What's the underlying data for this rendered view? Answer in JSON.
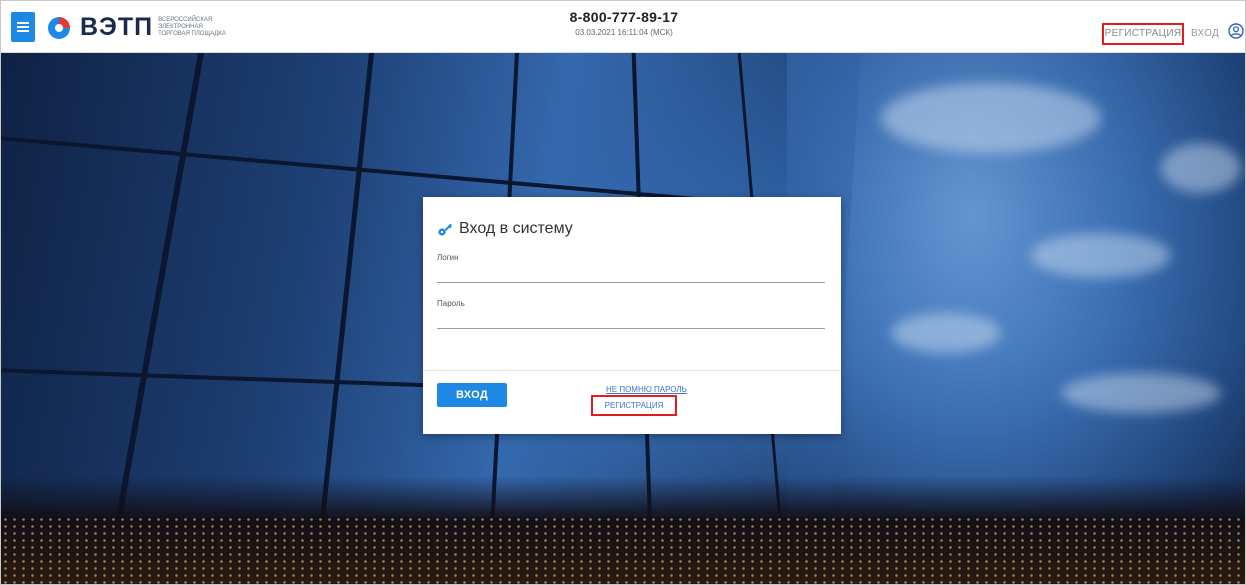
{
  "header": {
    "brand": {
      "word": "ВЭТП",
      "sub_lines": [
        "ВСЕРОССИЙСКАЯ",
        "ЭЛЕКТРОННАЯ",
        "ТОРГОВАЯ ПЛОЩАДКА"
      ]
    },
    "phone": "8-800-777-89-17",
    "datetime": "03.03.2021 16:11:04 (МСК)",
    "register_label": "РЕГИСТРАЦИЯ",
    "login_label": "ВХОД",
    "icons": {
      "menu": "hamburger-menu-icon",
      "user": "user-account-icon"
    }
  },
  "login_card": {
    "title": "Вход в систему",
    "icon": "key-icon",
    "login_label": "Логин",
    "login_value": "",
    "password_label": "Пароль",
    "password_value": "",
    "submit_label": "ВХОД",
    "forgot_label": "НЕ ПОМНЮ ПАРОЛЬ",
    "register_label": "РЕГИСТРАЦИЯ"
  },
  "colors": {
    "accent": "#1e88e5",
    "highlight_box": "#e21d1d",
    "link": "#3d74c8"
  }
}
